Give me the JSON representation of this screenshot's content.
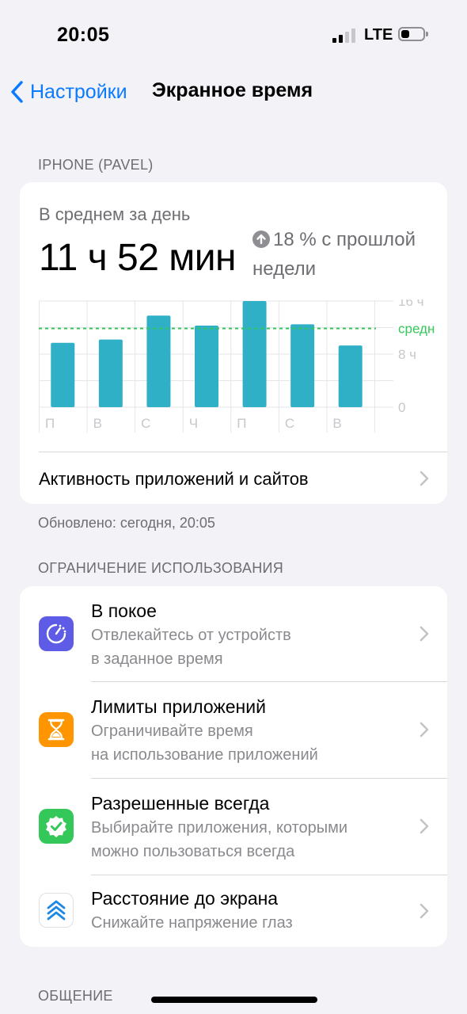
{
  "status": {
    "time": "20:05",
    "network": "LTE"
  },
  "nav": {
    "back_label": "Настройки",
    "title": "Экранное время"
  },
  "device_section": "IPHONE (PAVEL)",
  "summary": {
    "avg_label": "В среднем за день",
    "avg_value": "11 ч 52 мин",
    "change_text": "18 % с прошлой недели"
  },
  "chart_data": {
    "type": "bar",
    "categories": [
      "П",
      "В",
      "С",
      "Ч",
      "П",
      "С",
      "В"
    ],
    "values": [
      9.7,
      10.2,
      13.8,
      12.3,
      16.0,
      12.5,
      9.3
    ],
    "average": 11.87,
    "ylim": [
      0,
      16
    ],
    "y_ticks": [
      "16 ч",
      "8 ч",
      "0"
    ],
    "average_label": "средн.",
    "colors": {
      "bar": "#30b0c7",
      "average": "#34c759",
      "grid": "#e5e5ea"
    }
  },
  "activity_link": "Активность приложений и сайтов",
  "updated_text": "Обновлено: сегодня, 20:05",
  "limits_section": "ОГРАНИЧЕНИЕ ИСПОЛЬЗОВАНИЯ",
  "limits": [
    {
      "title": "В покое",
      "subtitle_1": "Отвлекайтесь от устройств",
      "subtitle_2": "в заданное время",
      "icon": "downtime-icon",
      "color": "#5e5ce6"
    },
    {
      "title": "Лимиты приложений",
      "subtitle_1": "Ограничивайте время",
      "subtitle_2": "на использование приложений",
      "icon": "hourglass-icon",
      "color": "#ff9500"
    },
    {
      "title": "Разрешенные всегда",
      "subtitle_1": "Выбирайте приложения, которыми",
      "subtitle_2": "можно пользоваться всегда",
      "icon": "checkmark-badge-icon",
      "color": "#34c759"
    },
    {
      "title": "Расстояние до экрана",
      "subtitle_1": "Снижайте напряжение глаз",
      "icon": "screen-distance-icon",
      "color": "#ffffff"
    }
  ],
  "communication_section": "ОБЩЕНИЕ"
}
